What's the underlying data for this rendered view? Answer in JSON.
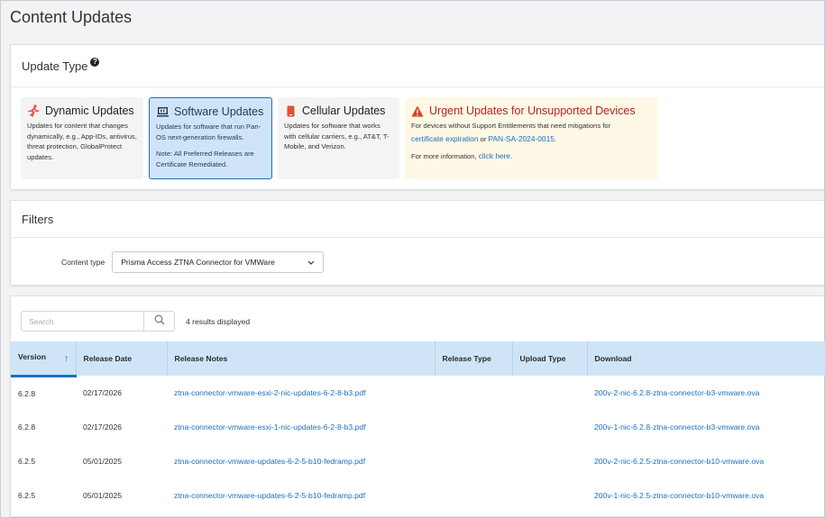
{
  "page": {
    "title": "Content Updates"
  },
  "update_type": {
    "title": "Update Type",
    "help_icon": "question-icon",
    "tiles": [
      {
        "icon": "running-person-icon",
        "title": "Dynamic Updates",
        "desc": "Updates for content that changes dynamically, e.g., App-IDs, antivirus, threat protection, GlobalProtect updates.",
        "selected": false
      },
      {
        "icon": "firewall-chip-icon",
        "title": "Software Updates",
        "desc": "Updates for software that run Pan-OS next-generation firewalls.",
        "note": "Note: All Preferred Releases are Certificate Remediated.",
        "selected": true
      },
      {
        "icon": "phone-icon",
        "title": "Cellular Updates",
        "desc": "Updates for software that works with cellular carriers, e.g., AT&T, T-Mobile, and Verizon.",
        "selected": false
      }
    ],
    "urgent": {
      "icon": "warning-icon",
      "title": "Urgent Updates for Unsupported Devices",
      "desc": "For devices without Support Entitlements that need mitigations for",
      "link1": "certificate expiration",
      "or_text": "or",
      "link2": "PAN-SA-2024-0015",
      "period": ".",
      "more_info": "For more information,",
      "click_here": "click here",
      "more_period": "."
    }
  },
  "filters": {
    "title": "Filters",
    "content_type_label": "Content type",
    "content_type_value": "Prisma Access ZTNA Connector for VMWare"
  },
  "results": {
    "search_placeholder": "Search",
    "count_text": "4 results displayed",
    "columns": [
      "Version",
      "Release Date",
      "Release Notes",
      "Release Type",
      "Upload Type",
      "Download"
    ],
    "sort_icon": "arrow-up-icon",
    "rows": [
      {
        "version": "6.2.8",
        "date": "02/17/2026",
        "notes": "ztna-connector-vmware-esxi-2-nic-updates-6-2-8-b3.pdf",
        "release_type": "",
        "upload_type": "",
        "download": "200v-2-nic-6.2.8-ztna-connector-b3-vmware.ova"
      },
      {
        "version": "6.2.8",
        "date": "02/17/2026",
        "notes": "ztna-connector-vmware-esxi-1-nic-updates-6-2-8-b3.pdf",
        "release_type": "",
        "upload_type": "",
        "download": "200v-1-nic-6.2.8-ztna-connector-b3-vmware.ova"
      },
      {
        "version": "6.2.5",
        "date": "05/01/2025",
        "notes": "ztna-connector-vmware-updates-6-2-5-b10-fedramp.pdf",
        "release_type": "",
        "upload_type": "",
        "download": "200v-2-nic-6.2.5-ztna-connector-b10-vmware.ova"
      },
      {
        "version": "6.2.5",
        "date": "05/01/2025",
        "notes": "ztna-connector-vmware-updates-6-2-5-b10-fedramp.pdf",
        "release_type": "",
        "upload_type": "",
        "download": "200v-1-nic-6.2.5-ztna-connector-b10-vmware.ova"
      }
    ]
  }
}
